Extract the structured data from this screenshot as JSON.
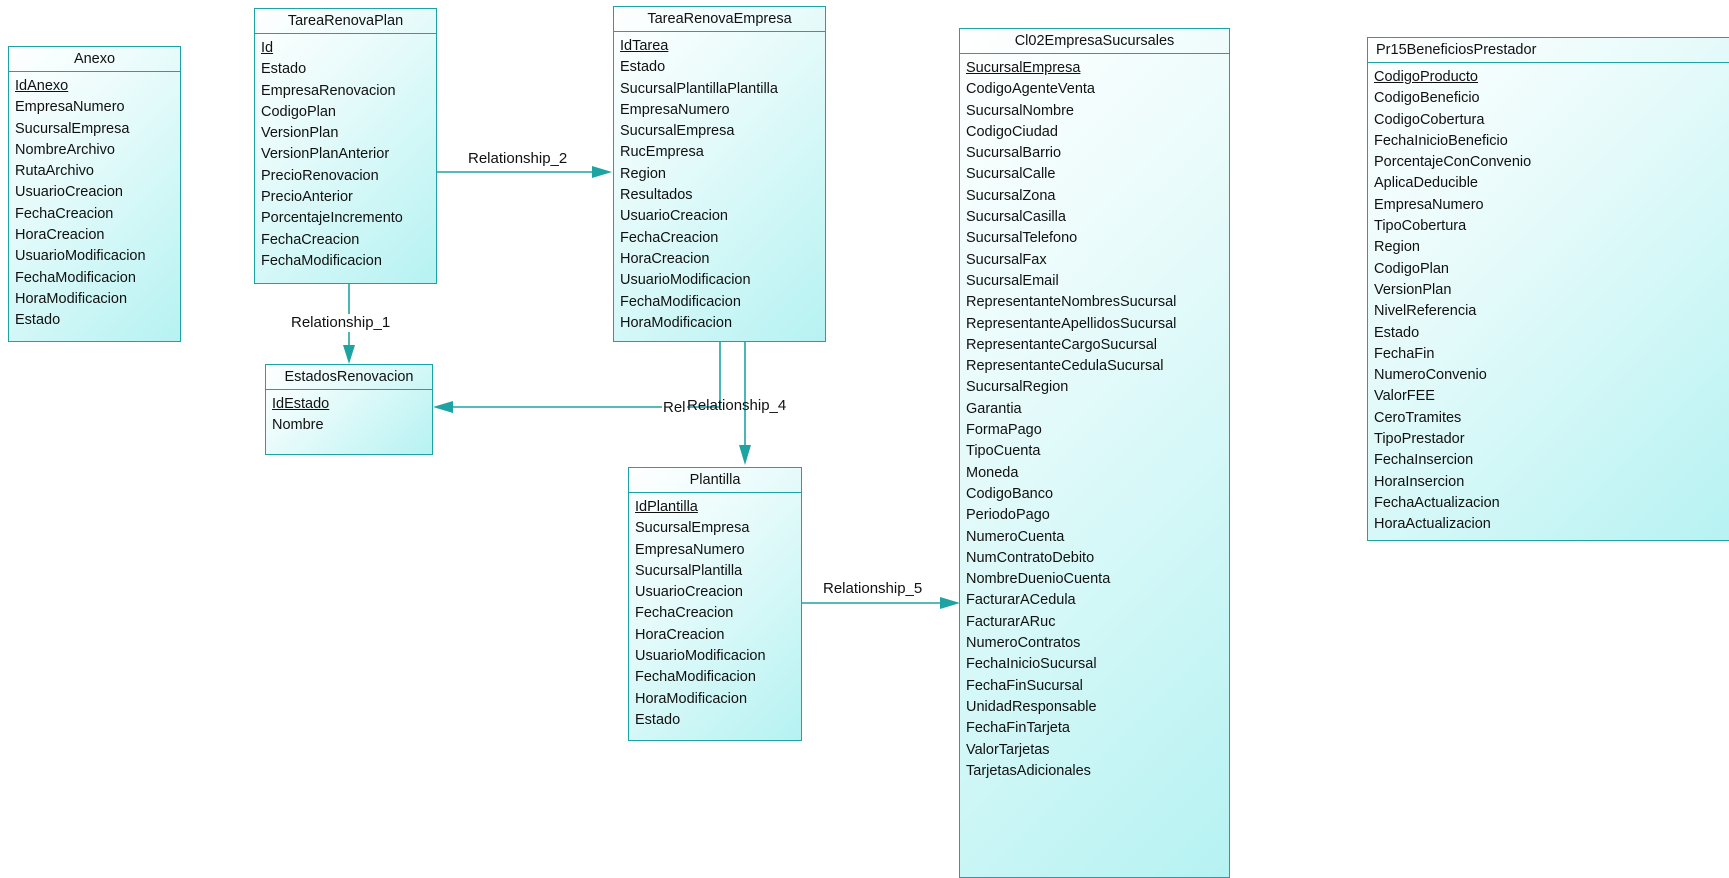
{
  "entities": {
    "anexo": {
      "name": "Anexo",
      "attributes": [
        {
          "name": "IdAnexo",
          "pk": true
        },
        {
          "name": "EmpresaNumero"
        },
        {
          "name": "SucursalEmpresa"
        },
        {
          "name": "NombreArchivo"
        },
        {
          "name": "RutaArchivo"
        },
        {
          "name": "UsuarioCreacion"
        },
        {
          "name": "FechaCreacion"
        },
        {
          "name": "HoraCreacion"
        },
        {
          "name": "UsuarioModificacion"
        },
        {
          "name": "FechaModificacion"
        },
        {
          "name": "HoraModificacion"
        },
        {
          "name": "Estado"
        }
      ]
    },
    "tarea_renova_plan": {
      "name": "TareaRenovaPlan",
      "attributes": [
        {
          "name": "Id",
          "pk": true
        },
        {
          "name": "Estado"
        },
        {
          "name": "EmpresaRenovacion"
        },
        {
          "name": "CodigoPlan"
        },
        {
          "name": "VersionPlan"
        },
        {
          "name": "VersionPlanAnterior"
        },
        {
          "name": "PrecioRenovacion"
        },
        {
          "name": "PrecioAnterior"
        },
        {
          "name": "PorcentajeIncremento"
        },
        {
          "name": "FechaCreacion"
        },
        {
          "name": "FechaModificacion"
        }
      ]
    },
    "tarea_renova_empresa": {
      "name": "TareaRenovaEmpresa",
      "attributes": [
        {
          "name": "IdTarea",
          "pk": true
        },
        {
          "name": "Estado"
        },
        {
          "name": "SucursalPlantillaPlantilla"
        },
        {
          "name": "EmpresaNumero"
        },
        {
          "name": "SucursalEmpresa"
        },
        {
          "name": "RucEmpresa"
        },
        {
          "name": "Region"
        },
        {
          "name": "Resultados"
        },
        {
          "name": "UsuarioCreacion"
        },
        {
          "name": "FechaCreacion"
        },
        {
          "name": "HoraCreacion"
        },
        {
          "name": "UsuarioModificacion"
        },
        {
          "name": "FechaModificacion"
        },
        {
          "name": "HoraModificacion"
        }
      ]
    },
    "estados_renovacion": {
      "name": "EstadosRenovacion",
      "attributes": [
        {
          "name": "IdEstado",
          "pk": true
        },
        {
          "name": "Nombre"
        }
      ]
    },
    "plantilla": {
      "name": "Plantilla",
      "attributes": [
        {
          "name": "IdPlantilla",
          "pk": true
        },
        {
          "name": "SucursalEmpresa"
        },
        {
          "name": "EmpresaNumero"
        },
        {
          "name": "SucursalPlantilla"
        },
        {
          "name": "UsuarioCreacion"
        },
        {
          "name": "FechaCreacion"
        },
        {
          "name": "HoraCreacion"
        },
        {
          "name": "UsuarioModificacion"
        },
        {
          "name": "FechaModificacion"
        },
        {
          "name": "HoraModificacion"
        },
        {
          "name": "Estado"
        }
      ]
    },
    "cl02_empresa_sucursales": {
      "name": "Cl02EmpresaSucursales",
      "attributes": [
        {
          "name": "SucursalEmpresa",
          "pk": true
        },
        {
          "name": "CodigoAgenteVenta"
        },
        {
          "name": "SucursalNombre"
        },
        {
          "name": "CodigoCiudad"
        },
        {
          "name": "SucursalBarrio"
        },
        {
          "name": "SucursalCalle"
        },
        {
          "name": "SucursalZona"
        },
        {
          "name": "SucursalCasilla"
        },
        {
          "name": "SucursalTelefono"
        },
        {
          "name": "SucursalFax"
        },
        {
          "name": "SucursalEmail"
        },
        {
          "name": "RepresentanteNombresSucursal"
        },
        {
          "name": "RepresentanteApellidosSucursal"
        },
        {
          "name": "RepresentanteCargoSucursal"
        },
        {
          "name": "RepresentanteCedulaSucursal"
        },
        {
          "name": "SucursalRegion"
        },
        {
          "name": "Garantia"
        },
        {
          "name": "FormaPago"
        },
        {
          "name": "TipoCuenta"
        },
        {
          "name": "Moneda"
        },
        {
          "name": "CodigoBanco"
        },
        {
          "name": "PeriodoPago"
        },
        {
          "name": "NumeroCuenta"
        },
        {
          "name": "NumContratoDebito"
        },
        {
          "name": "NombreDuenioCuenta"
        },
        {
          "name": "FacturarACedula"
        },
        {
          "name": "FacturarARuc"
        },
        {
          "name": "NumeroContratos"
        },
        {
          "name": "FechaInicioSucursal"
        },
        {
          "name": "FechaFinSucursal"
        },
        {
          "name": "UnidadResponsable"
        },
        {
          "name": "FechaFinTarjeta"
        },
        {
          "name": "ValorTarjetas"
        },
        {
          "name": "TarjetasAdicionales"
        }
      ]
    },
    "pr15_beneficios_prestador": {
      "name": "Pr15BeneficiosPrestador",
      "attributes": [
        {
          "name": "CodigoProducto",
          "pk": true
        },
        {
          "name": "CodigoBeneficio"
        },
        {
          "name": "CodigoCobertura"
        },
        {
          "name": "FechaInicioBeneficio"
        },
        {
          "name": "PorcentajeConConvenio"
        },
        {
          "name": "AplicaDeducible"
        },
        {
          "name": "EmpresaNumero"
        },
        {
          "name": "TipoCobertura"
        },
        {
          "name": "Region"
        },
        {
          "name": "CodigoPlan"
        },
        {
          "name": "VersionPlan"
        },
        {
          "name": "NivelReferencia"
        },
        {
          "name": "Estado"
        },
        {
          "name": "FechaFin"
        },
        {
          "name": "NumeroConvenio"
        },
        {
          "name": "ValorFEE"
        },
        {
          "name": "CeroTramites"
        },
        {
          "name": "TipoPrestador"
        },
        {
          "name": "FechaInsercion"
        },
        {
          "name": "HoraInsercion"
        },
        {
          "name": "FechaActualizacion"
        },
        {
          "name": "HoraActualizacion"
        }
      ]
    }
  },
  "relationships": {
    "r1": {
      "label": "Relationship_1",
      "from": "TareaRenovaPlan",
      "to": "EstadosRenovacion"
    },
    "r2": {
      "label": "Relationship_2",
      "from": "TareaRenovaPlan",
      "to": "TareaRenovaEmpresa"
    },
    "r3": {
      "label": "Rel",
      "from": "TareaRenovaEmpresa",
      "to": "EstadosRenovacion"
    },
    "r4": {
      "label": "Relationship_4",
      "from": "TareaRenovaEmpresa",
      "to": "Plantilla"
    },
    "r5": {
      "label": "Relationship_5",
      "from": "Plantilla",
      "to": "Cl02EmpresaSucursales"
    }
  },
  "colors": {
    "line": "#1ea3a3",
    "border": "#1ea3a3",
    "fill_light": "#e9fbfb",
    "fill_dark": "#b6f2f2"
  }
}
